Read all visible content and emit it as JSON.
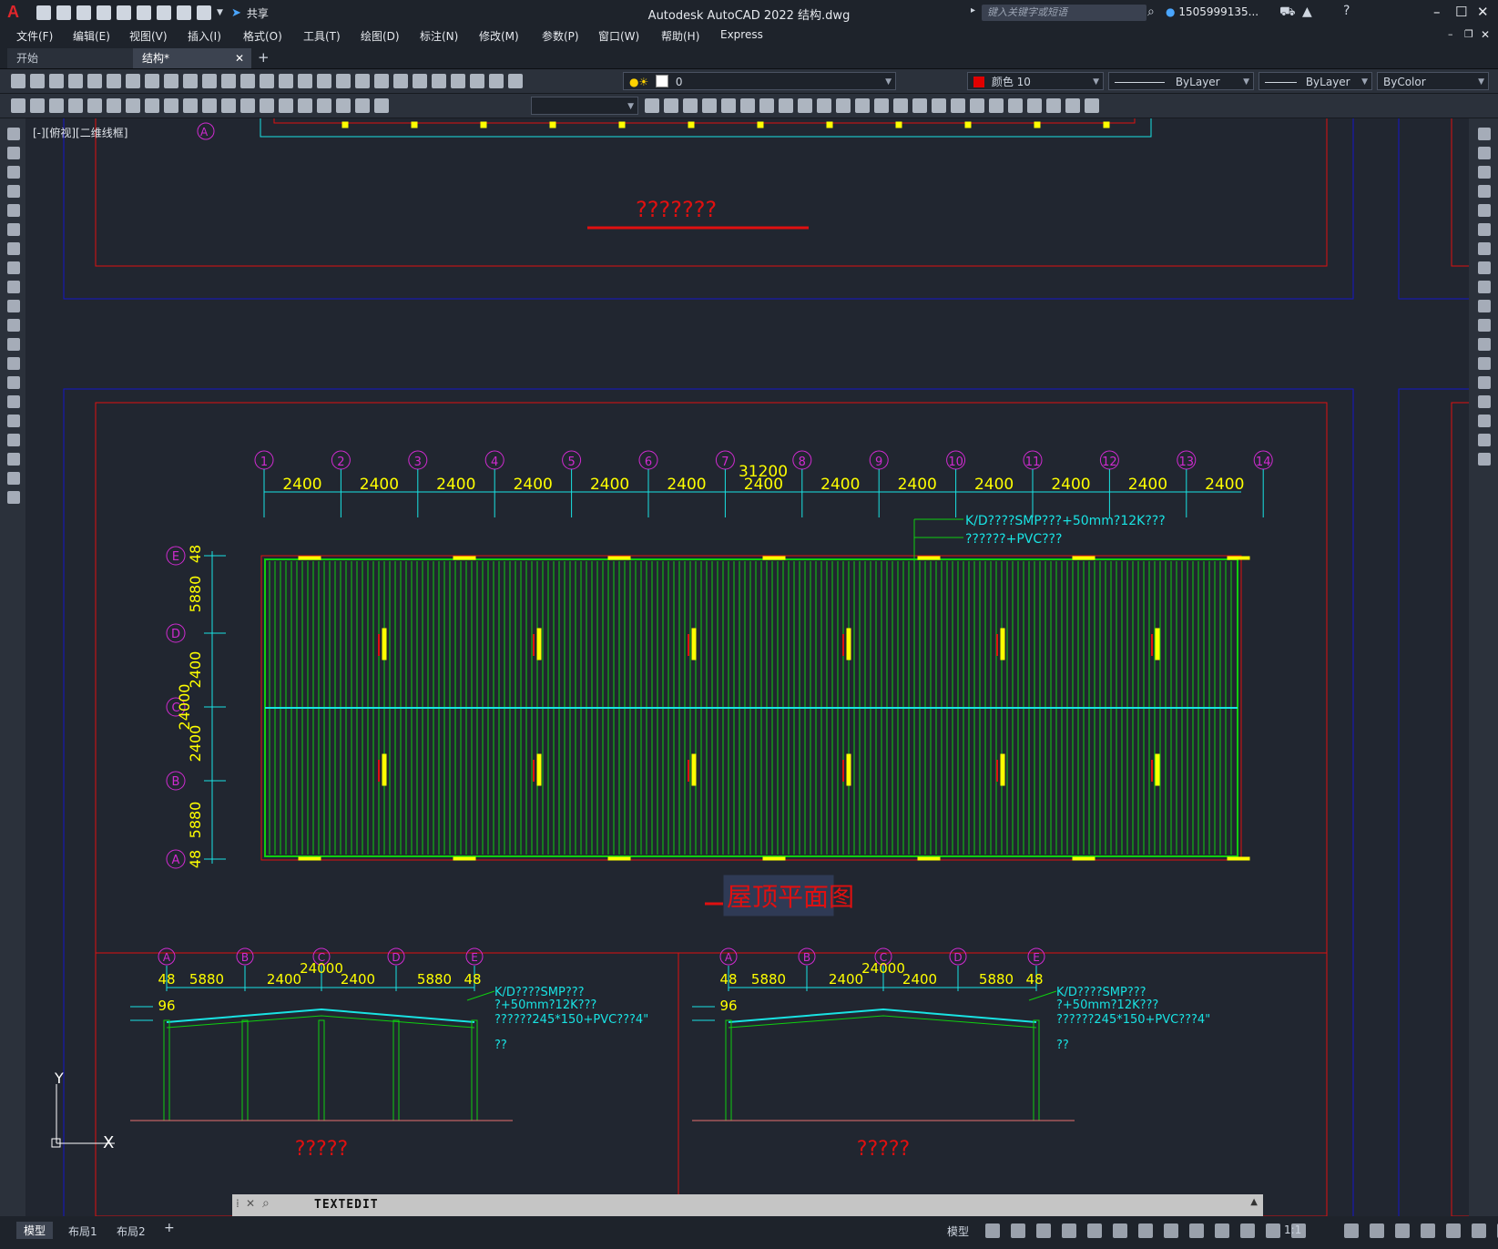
{
  "app": {
    "title": "Autodesk AutoCAD 2022    结构.dwg",
    "share_label": "共享",
    "search_placeholder": "键入关键字或短语",
    "user": "1505999135...",
    "menus": [
      "文件(F)",
      "编辑(E)",
      "视图(V)",
      "插入(I)",
      "格式(O)",
      "工具(T)",
      "绘图(D)",
      "标注(N)",
      "修改(M)",
      "参数(P)",
      "窗口(W)",
      "帮助(H)",
      "Express"
    ],
    "tabs": {
      "start": "开始",
      "current": "结构*",
      "add": "+"
    }
  },
  "toolbar": {
    "layer_value": "0",
    "color_value": "颜色 10",
    "color_hex": "#e00000",
    "linetype_value": "ByLayer",
    "lineweight_value": "ByLayer",
    "plotstyle_value": "ByColor"
  },
  "viewport": {
    "label": "[-][俯视][二维线框]"
  },
  "drawing": {
    "top_title": "???????",
    "grid_top": [
      "1",
      "2",
      "3",
      "4",
      "5",
      "6",
      "7",
      "8",
      "9",
      "10",
      "11",
      "12",
      "13",
      "14"
    ],
    "spacing_label": "2400",
    "total_dim": "31200",
    "left_grid": [
      "E",
      "D",
      "C",
      "B",
      "A"
    ],
    "left_dims": [
      "48",
      "5880",
      "2400",
      "2400",
      "5880",
      "48"
    ],
    "left_total": "24000",
    "note_1": "K/D????SMP???+50mm?12K???",
    "note_2": "??????+PVC???",
    "plan_title": "屋顶平面图",
    "section_grid": [
      "A",
      "B",
      "C",
      "D",
      "E"
    ],
    "section_dims": [
      "48",
      "5880",
      "2400",
      "2400",
      "5880",
      "48"
    ],
    "section_total": "24000",
    "section_height": "96",
    "section_note_1": "K/D????SMP???",
    "section_note_2": "?+50mm?12K???",
    "section_note_3": "??????245*150+PVC???4\"",
    "section_note_4": "??",
    "section_title_1": "?????",
    "section_title_2": "?????",
    "ucs_x": "X",
    "ucs_y": "Y",
    "colors": {
      "cyan": "#19e3e3",
      "yellow": "#ffff00",
      "magenta": "#d02bd0",
      "red": "#e01010",
      "green": "#0fcf0f",
      "blue": "#1515c8"
    }
  },
  "command": {
    "text": "TEXTEDIT"
  },
  "status": {
    "layout_tabs": [
      "模型",
      "布局1",
      "布局2"
    ],
    "add": "+",
    "model": "模型",
    "scale": "1:1"
  }
}
